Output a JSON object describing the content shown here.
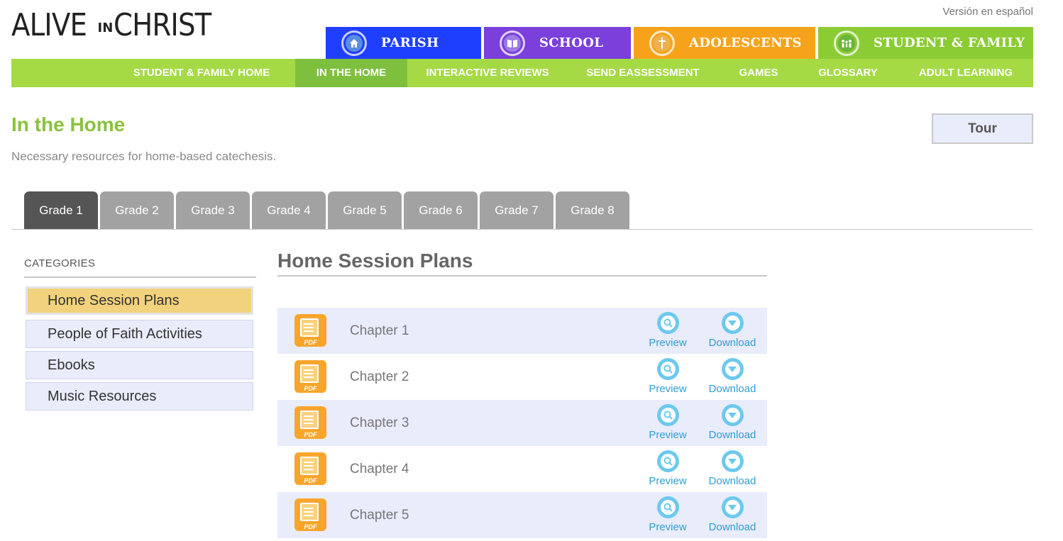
{
  "logo": {
    "alive": "ALIVE",
    "in": "IN",
    "christ": "CHRIST"
  },
  "language_link": "Versión en español",
  "audience_tabs": [
    {
      "label": "PARISH",
      "icon": "home-icon",
      "color": "#1f3fff"
    },
    {
      "label": "SCHOOL",
      "icon": "book-icon",
      "color": "#7b3fdc"
    },
    {
      "label": "ADOLESCENTS",
      "icon": "cross-icon",
      "color": "#f6a31b"
    },
    {
      "label": "STUDENT & FAMILY",
      "icon": "family-icon",
      "color": "#8bcc34"
    }
  ],
  "subnav": {
    "items": [
      {
        "label": "STUDENT & FAMILY HOME",
        "active": false
      },
      {
        "label": "IN THE HOME",
        "active": true
      },
      {
        "label": "INTERACTIVE REVIEWS",
        "active": false
      },
      {
        "label": "SEND EASSESSMENT",
        "active": false
      },
      {
        "label": "GAMES",
        "active": false
      },
      {
        "label": "GLOSSARY",
        "active": false
      },
      {
        "label": "ADULT LEARNING",
        "active": false
      }
    ]
  },
  "page": {
    "title": "In the Home",
    "subtitle": "Necessary resources for home-based catechesis.",
    "tour_label": "Tour"
  },
  "grade_tabs": [
    {
      "label": "Grade 1",
      "active": true
    },
    {
      "label": "Grade 2",
      "active": false
    },
    {
      "label": "Grade 3",
      "active": false
    },
    {
      "label": "Grade 4",
      "active": false
    },
    {
      "label": "Grade 5",
      "active": false
    },
    {
      "label": "Grade 6",
      "active": false
    },
    {
      "label": "Grade 7",
      "active": false
    },
    {
      "label": "Grade 8",
      "active": false
    }
  ],
  "categories": {
    "heading": "CATEGORIES",
    "items": [
      {
        "label": "Home Session Plans",
        "active": true
      },
      {
        "label": "People of Faith Activities",
        "active": false
      },
      {
        "label": "Ebooks",
        "active": false
      },
      {
        "label": "Music Resources",
        "active": false
      }
    ]
  },
  "resources": {
    "section_title": "Home Session Plans",
    "file_icon_label": "PDF",
    "preview_label": "Preview",
    "download_label": "Download",
    "rows": [
      {
        "label": "Chapter 1"
      },
      {
        "label": "Chapter 2"
      },
      {
        "label": "Chapter 3"
      },
      {
        "label": "Chapter 4"
      },
      {
        "label": "Chapter 5"
      }
    ]
  },
  "colors": {
    "brand_green": "#a5da44",
    "active_green": "#7ec03d",
    "title_green": "#8ac23c",
    "active_category": "#f2d27c",
    "row_shade": "#e9ecfb",
    "link_blue": "#2e9ed6",
    "pdf_orange": "#f8a52c"
  }
}
